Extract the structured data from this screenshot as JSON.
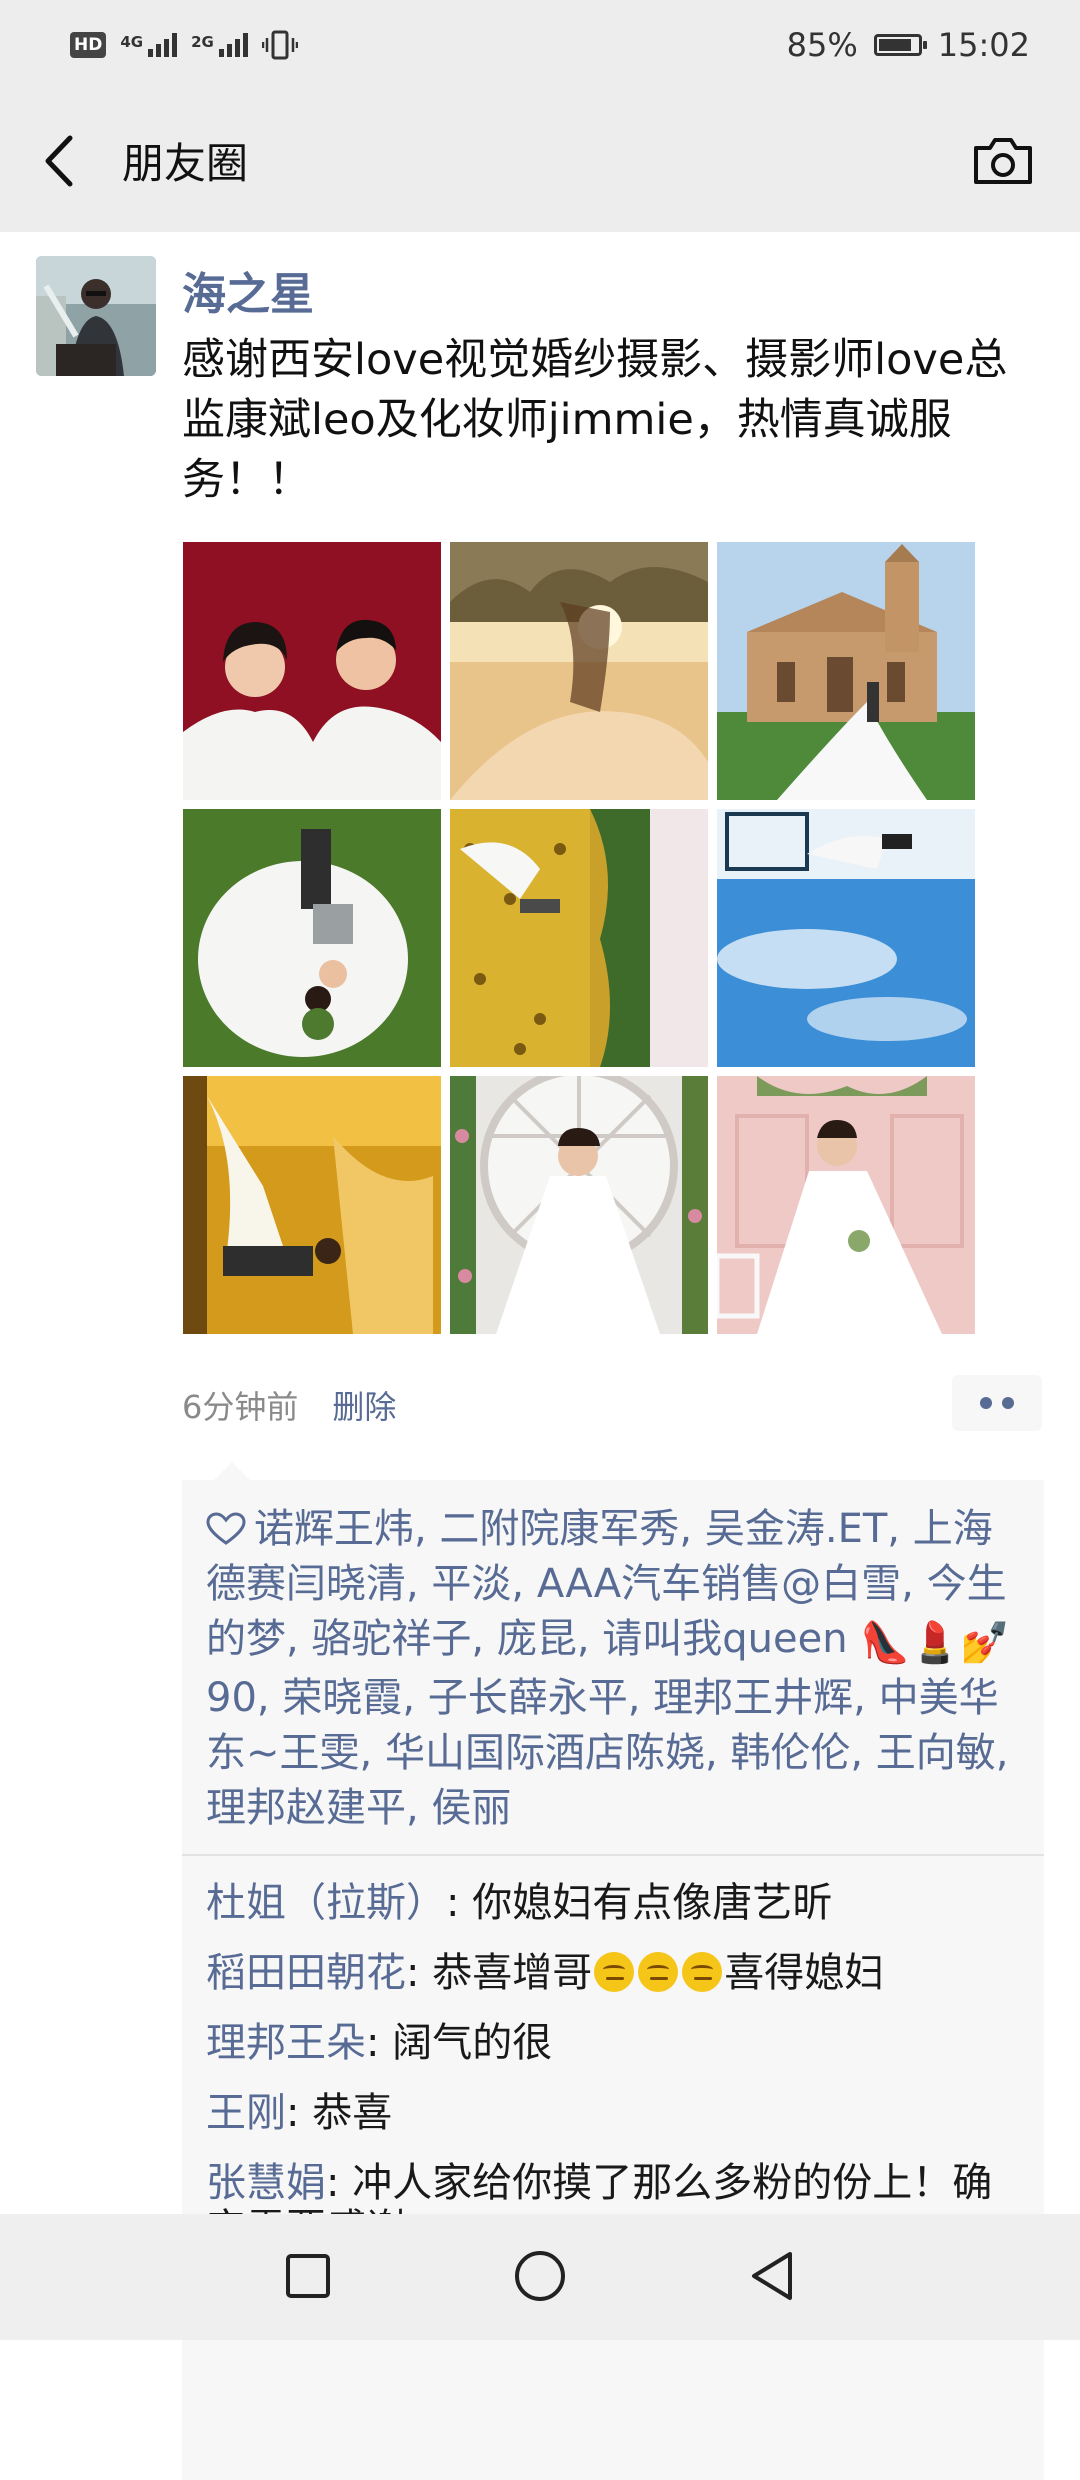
{
  "status_bar": {
    "hd_label": "HD",
    "network_1": "4G",
    "network_2": "2G",
    "battery_percent": "85%",
    "battery_level": 0.85,
    "time": "15:02"
  },
  "nav": {
    "title": "朋友圈",
    "back_icon": "chevron-left-icon",
    "camera_icon": "camera-icon"
  },
  "post": {
    "author": "海之星",
    "text": "感谢西安love视觉婚纱摄影、摄影师love总监康斌leo及化妆师jimmie，热情真诚服务！！",
    "photos": [
      "couple portrait on red background",
      "couple silhouette in sunset",
      "bride and groom in front of church",
      "bride lying on grass",
      "couple in sunflower field",
      "couple under blue sky",
      "couple in golden autumn trees",
      "bride in white gown with arch",
      "bride sitting in pink room"
    ],
    "time_ago": "6分钟前",
    "delete_label": "删除",
    "more_icon": "more-dots-icon"
  },
  "likes": {
    "icon": "heart-outline-icon",
    "part1": "诺辉王炜, 二附院康军秀, 吴金涛.ET, 上海德赛闫晓清, 平淡, AAA汽车销售@白雪, 今生的梦, 骆驼祥子, 庞昆, 请叫我queen ",
    "emojis": "👠💄💅",
    "part2": "90, 荣晓霞, 子长薛永平, 理邦王井辉, 中美华东~王雯, 华山国际酒店陈娆, 韩伦伦, 王向敏, 理邦赵建平, 侯丽"
  },
  "comments": [
    {
      "author": "杜姐（拉斯）",
      "text": ": 你媳妇有点像唐艺昕"
    },
    {
      "author": "稻田田朝花",
      "text": ": 恭喜增哥",
      "text2": "喜得媳妇"
    },
    {
      "author": "理邦王朵",
      "text": ": 阔气的很"
    },
    {
      "author": "王刚",
      "text": ": 恭喜"
    },
    {
      "author": "张慧娟",
      "text": ": 冲人家给你摸了那么多粉的份上！确实需要感谢"
    }
  ],
  "system_nav": {
    "recent_icon": "square-icon",
    "home_icon": "circle-icon",
    "back_icon": "triangle-back-icon"
  }
}
